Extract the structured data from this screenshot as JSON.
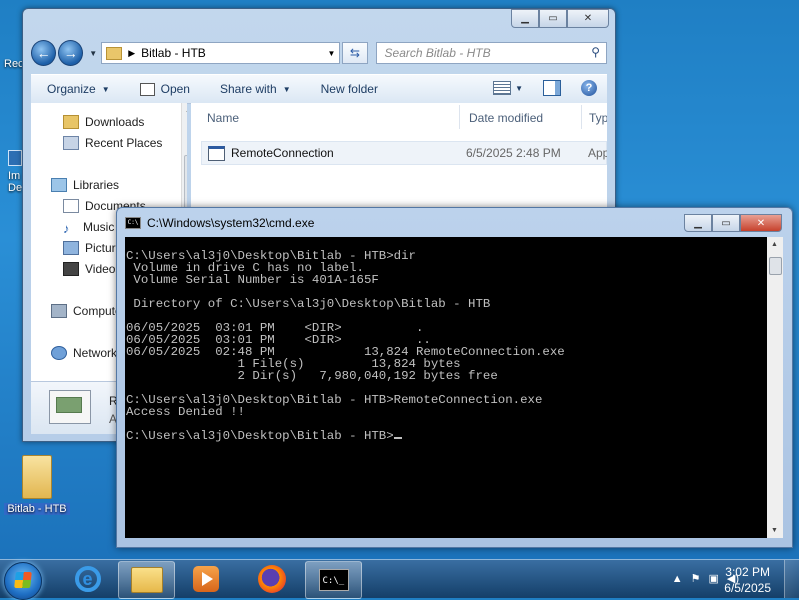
{
  "desktop": {
    "icons": [
      {
        "label": "Rec"
      },
      {
        "label": "Im\nDe"
      },
      {
        "label": "Bitlab - HTB"
      }
    ]
  },
  "explorer": {
    "address": {
      "path": "Bitlab - HTB"
    },
    "search": {
      "placeholder": "Search Bitlab - HTB"
    },
    "toolbar": {
      "organize": "Organize",
      "open": "Open",
      "share_with": "Share with",
      "new_folder": "New folder"
    },
    "nav": {
      "items": [
        {
          "label": "Downloads",
          "icon": "downloads-folder-icon"
        },
        {
          "label": "Recent Places",
          "icon": "recent-places-icon"
        },
        {
          "label": "Libraries",
          "icon": "libraries-icon"
        },
        {
          "label": "Documents",
          "icon": "documents-icon"
        },
        {
          "label": "Music",
          "icon": "music-icon"
        },
        {
          "label": "Pictures",
          "icon": "pictures-icon"
        },
        {
          "label": "Videos",
          "icon": "videos-icon"
        },
        {
          "label": "Computer",
          "icon": "computer-icon"
        },
        {
          "label": "Network",
          "icon": "network-icon"
        }
      ]
    },
    "columns": {
      "name": "Name",
      "date_modified": "Date modified",
      "type": "Typ"
    },
    "files": [
      {
        "name": "RemoteConnection",
        "date": "6/5/2025 2:48 PM",
        "type": "App"
      }
    ],
    "details": {
      "line1": "R",
      "line2": "A"
    }
  },
  "cmd": {
    "title": "C:\\Windows\\system32\\cmd.exe",
    "lines": [
      "C:\\Users\\al3j0\\Desktop\\Bitlab - HTB>dir",
      " Volume in drive C has no label.",
      " Volume Serial Number is 401A-165F",
      "",
      " Directory of C:\\Users\\al3j0\\Desktop\\Bitlab - HTB",
      "",
      "06/05/2025  03:01 PM    <DIR>          .",
      "06/05/2025  03:01 PM    <DIR>          ..",
      "06/05/2025  02:48 PM            13,824 RemoteConnection.exe",
      "               1 File(s)         13,824 bytes",
      "               2 Dir(s)   7,980,040,192 bytes free",
      "",
      "C:\\Users\\al3j0\\Desktop\\Bitlab - HTB>RemoteConnection.exe",
      "Access Denied !!",
      ""
    ],
    "prompt": "C:\\Users\\al3j0\\Desktop\\Bitlab - HTB>"
  },
  "taskbar": {
    "clock": {
      "time": "3:02 PM",
      "date": "6/5/2025"
    }
  }
}
